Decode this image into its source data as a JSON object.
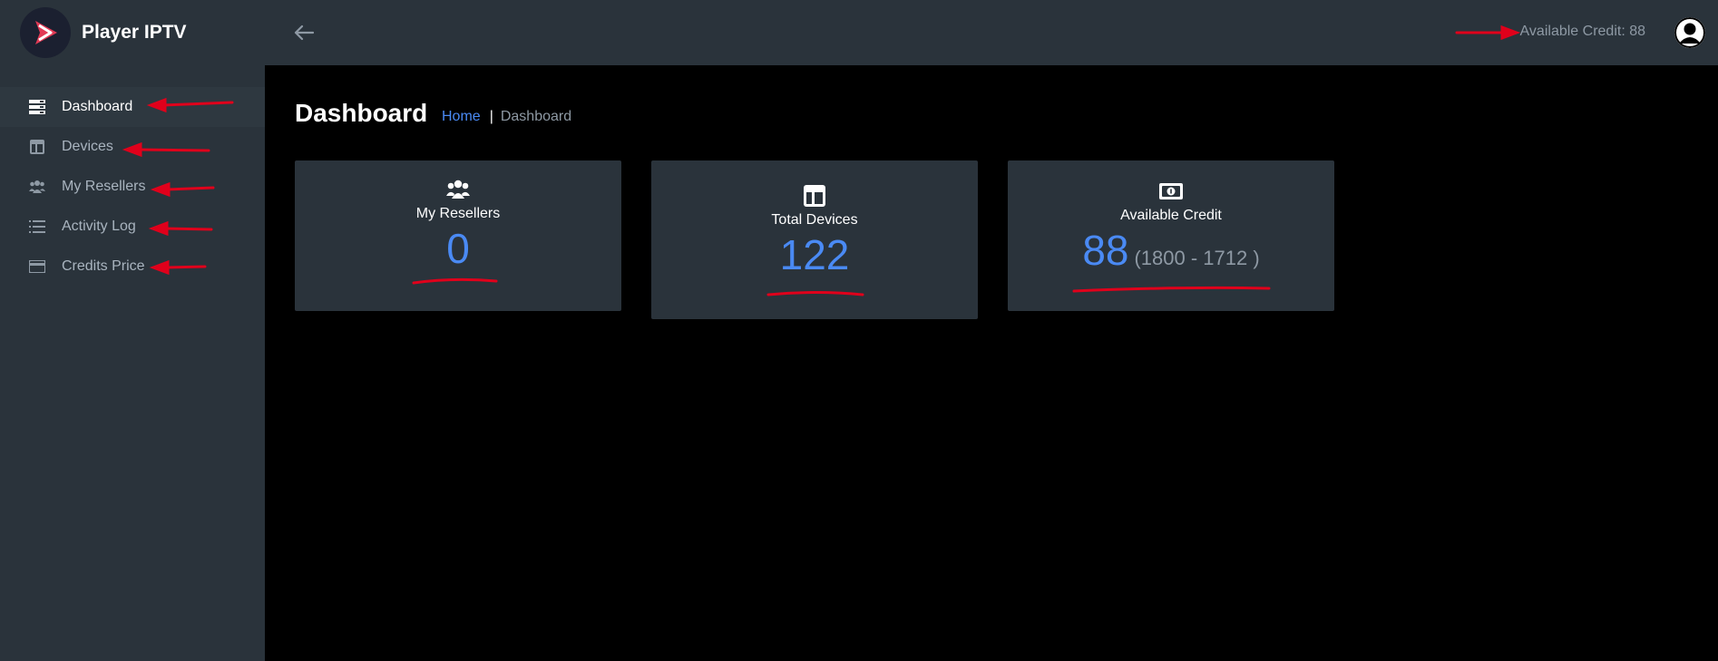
{
  "brand": {
    "name": "Player IPTV"
  },
  "sidebar": {
    "items": [
      {
        "label": "Dashboard",
        "icon": "dashboard-icon",
        "active": true
      },
      {
        "label": "Devices",
        "icon": "devices-icon",
        "active": false
      },
      {
        "label": "My Resellers",
        "icon": "users-icon",
        "active": false
      },
      {
        "label": "Activity Log",
        "icon": "list-icon",
        "active": false
      },
      {
        "label": "Credits Price",
        "icon": "credit-card-icon",
        "active": false
      }
    ]
  },
  "header": {
    "available_credit": "Available Credit: 88"
  },
  "page": {
    "title": "Dashboard",
    "breadcrumb": {
      "home": "Home",
      "current": "Dashboard"
    }
  },
  "cards": {
    "resellers": {
      "label": "My Resellers",
      "value": "0",
      "icon": "users-icon"
    },
    "devices": {
      "label": "Total Devices",
      "value": "122",
      "icon": "devices-icon"
    },
    "credit": {
      "label": "Available Credit",
      "value": "88",
      "detail": "(1800 - 1712 )",
      "icon": "money-icon"
    }
  },
  "colors": {
    "background": "#000000",
    "panel": "#2a333b",
    "accent": "#4a8af4",
    "muted": "#8e99a4",
    "annotation": "#e0001b"
  }
}
